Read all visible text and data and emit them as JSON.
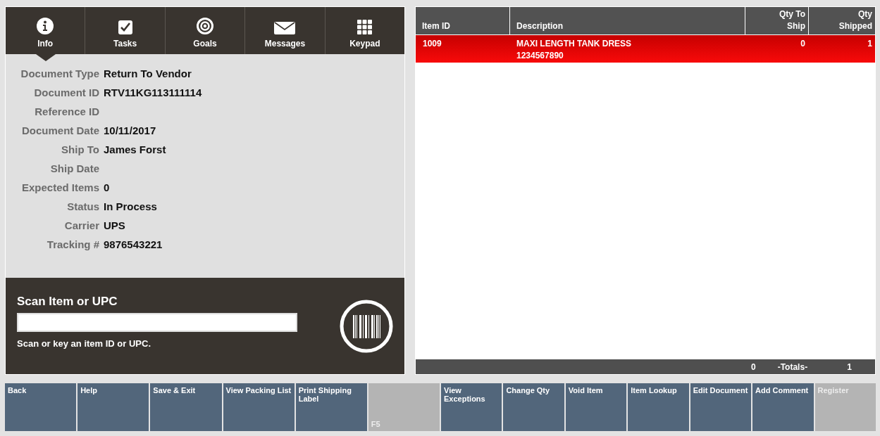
{
  "tabs": [
    {
      "label": "Info",
      "selected": true
    },
    {
      "label": "Tasks",
      "selected": false
    },
    {
      "label": "Goals",
      "selected": false
    },
    {
      "label": "Messages",
      "selected": false
    },
    {
      "label": "Keypad",
      "selected": false
    }
  ],
  "details": [
    {
      "label": "Document Type",
      "value": "Return To Vendor"
    },
    {
      "label": "Document ID",
      "value": "RTV11KG113111114"
    },
    {
      "label": "Reference ID"
    },
    {
      "label": "Document Date",
      "value": "10/11/2017"
    },
    {
      "label": "Ship To",
      "value": "James Forst"
    },
    {
      "label": "Ship Date"
    },
    {
      "label": "Expected Items",
      "value": "0"
    },
    {
      "label": "Status",
      "value": "In Process"
    },
    {
      "label": "Carrier",
      "value": "UPS"
    },
    {
      "label": "Tracking #",
      "value": "9876543221"
    }
  ],
  "scan": {
    "title": "Scan Item or UPC",
    "hint": "Scan or key an item ID or UPC."
  },
  "table": {
    "columns": [
      "Item ID",
      "Description",
      [
        "Qty To",
        "Ship"
      ],
      [
        "Qty",
        "Shipped"
      ]
    ],
    "rows": [
      {
        "item_id": "1009",
        "description": "MAXI LENGTH TANK DRESS",
        "upc": "1234567890",
        "qty_to_ship": "0",
        "qty_shipped": "1",
        "selected": true
      }
    ],
    "totals": {
      "qty_to_ship": "0",
      "label": "-Totals-",
      "qty_shipped": "1"
    }
  },
  "buttons_left": [
    {
      "label": "Back",
      "disabled": false
    },
    {
      "label": "Help",
      "disabled": false
    },
    {
      "label": "Save & Exit",
      "disabled": false
    },
    {
      "label": "View Packing List",
      "disabled": false
    },
    {
      "label": "Print Shipping Label",
      "disabled": false
    },
    {
      "hint": "F5",
      "disabled": true
    }
  ],
  "buttons_right": [
    {
      "label": "View Exceptions",
      "disabled": false
    },
    {
      "label": "Change Qty",
      "disabled": false
    },
    {
      "label": "Void Item",
      "disabled": false
    },
    {
      "label": "Item Lookup",
      "disabled": false
    },
    {
      "label": "Edit Document",
      "disabled": false
    },
    {
      "label": "Add Comment",
      "disabled": false
    },
    {
      "label": "Register",
      "disabled": true
    }
  ]
}
